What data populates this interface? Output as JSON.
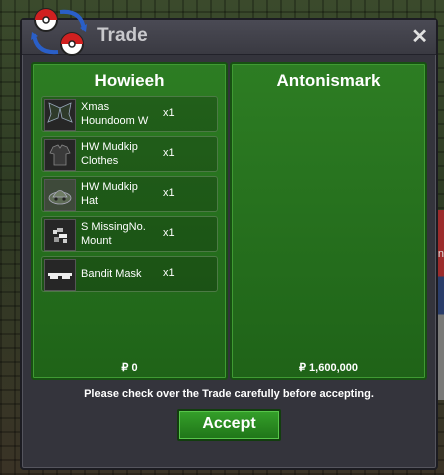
{
  "window": {
    "title": "Trade",
    "close_symbol": "✕"
  },
  "left_panel": {
    "player": "Howieeh",
    "items": [
      {
        "name_line1": "Xmas",
        "name_line2": "Houndoom W",
        "qty": "x1",
        "icon": "wings-icon"
      },
      {
        "name_line1": "HW Mudkip",
        "name_line2": "Clothes",
        "qty": "x1",
        "icon": "clothes-icon"
      },
      {
        "name_line1": "HW Mudkip",
        "name_line2": "Hat",
        "qty": "x1",
        "icon": "hat-icon"
      },
      {
        "name_line1": "S MissingNo.",
        "name_line2": "Mount",
        "qty": "x1",
        "icon": "mount-icon"
      },
      {
        "name_line1": "Bandit Mask",
        "name_line2": "",
        "qty": "x1",
        "icon": "mask-icon"
      }
    ],
    "money": "₽ 0"
  },
  "right_panel": {
    "player": "Antonismark",
    "items": [],
    "money": "₽ 1,600,000"
  },
  "notice": "Please check over the Trade carefully before accepting.",
  "accept_label": "Accept",
  "colors": {
    "panel_green": "#2d7d23",
    "window_gray": "#34343c",
    "accept_green": "#2b8a22"
  }
}
